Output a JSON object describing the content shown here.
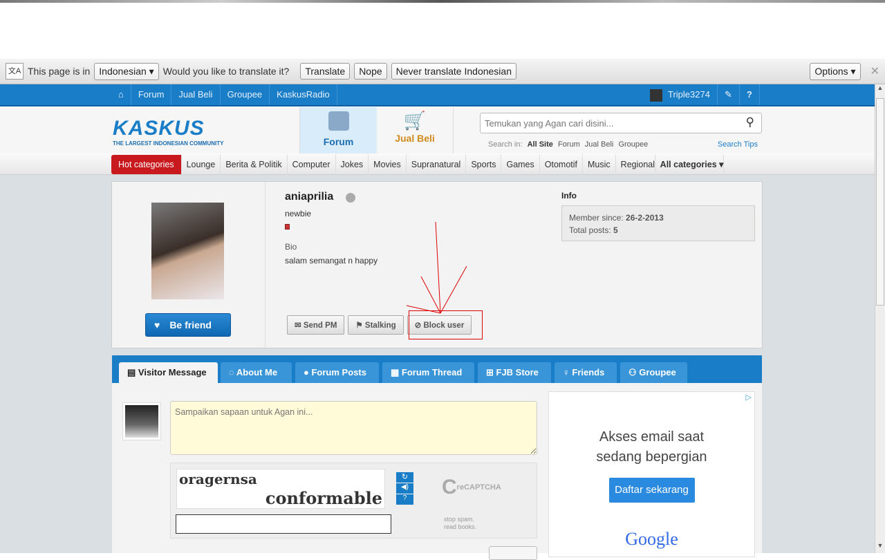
{
  "translate_bar": {
    "prefix": "This page is in",
    "language": "Indonesian",
    "question": "Would you like to translate it?",
    "translate": "Translate",
    "nope": "Nope",
    "never": "Never translate Indonesian",
    "options": "Options"
  },
  "nav": {
    "items": [
      "Forum",
      "Jual Beli",
      "Groupee",
      "KaskusRadio"
    ],
    "username": "Triple3274"
  },
  "header": {
    "logo": "KASKUS",
    "tagline": "THE LARGEST INDONESIAN COMMUNITY",
    "forum": "Forum",
    "jualbeli": "Jual Beli",
    "search_placeholder": "Temukan yang Agan cari disini...",
    "search_in": "Search in:",
    "scopes": [
      "All Site",
      "Forum",
      "Jual Beli",
      "Groupee"
    ],
    "search_tips": "Search Tips"
  },
  "categories": {
    "hot": "Hot categories",
    "items": [
      "Lounge",
      "Berita & Politik",
      "Computer",
      "Jokes",
      "Movies",
      "Supranatural",
      "Sports",
      "Games",
      "Otomotif",
      "Music",
      "Regional"
    ],
    "all": "All categories"
  },
  "profile": {
    "name": "aniaprilia",
    "rank": "newbie",
    "bio_label": "Bio",
    "bio": "salam semangat n happy",
    "befriend": "Be friend",
    "send_pm": "Send PM",
    "stalking": "Stalking",
    "block": "Block user",
    "info_label": "Info",
    "member_since_label": "Member since:",
    "member_since": "26-2-2013",
    "total_posts_label": "Total posts:",
    "total_posts": "5"
  },
  "tabs": [
    "Visitor Message",
    "About Me",
    "Forum Posts",
    "Forum Thread",
    "FJB Store",
    "Friends",
    "Groupee"
  ],
  "message": {
    "placeholder": "Sampaikan sapaan untuk Agan ini...",
    "captcha_word1": "oragernsa",
    "captcha_word2": "conformable",
    "recaptcha": "reCAPTCHA",
    "recaptcha_tag1": "stop spam.",
    "recaptcha_tag2": "read books."
  },
  "ad": {
    "line1": "Akses email saat",
    "line2": "sedang bepergian",
    "button": "Daftar sekarang",
    "brand": "Google"
  }
}
